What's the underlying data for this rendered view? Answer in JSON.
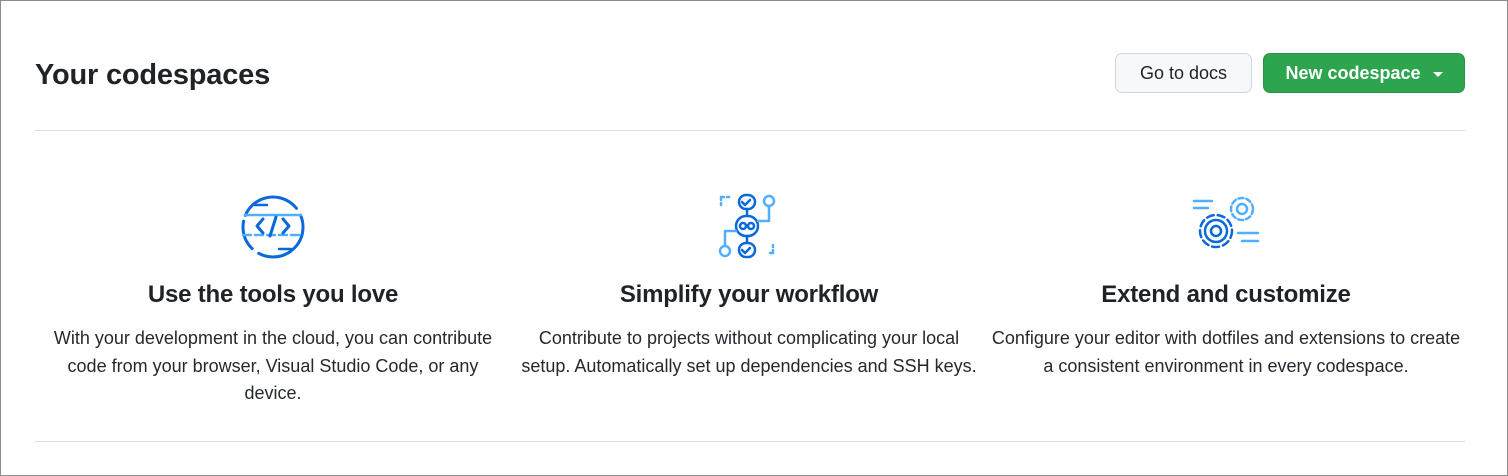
{
  "header": {
    "title": "Your codespaces",
    "docs_button": "Go to docs",
    "new_button": "New codespace"
  },
  "features": [
    {
      "icon": "code-browser-icon",
      "title": "Use the tools you love",
      "description": "With your development in the cloud, you can contribute code from your browser, Visual Studio Code, or any device."
    },
    {
      "icon": "workflow-icon",
      "title": "Simplify your workflow",
      "description": "Contribute to projects without complicating your local setup. Automatically set up dependencies and SSH keys."
    },
    {
      "icon": "gears-icon",
      "title": "Extend and customize",
      "description": "Configure your editor with dotfiles and extensions to create a consistent environment in every codespace."
    }
  ],
  "colors": {
    "primary_button": "#2da44e",
    "icon_accent": "#0969da",
    "icon_light": "#54aeff"
  }
}
